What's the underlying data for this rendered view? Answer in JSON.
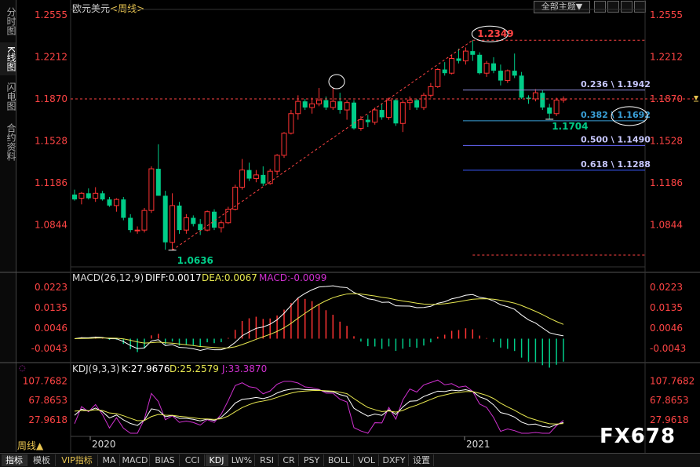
{
  "sidebar": {
    "tabs": [
      {
        "label": "分时图",
        "active": false
      },
      {
        "label": "K线图",
        "active": true
      },
      {
        "label": "闪电图",
        "active": false
      },
      {
        "label": "合约资料",
        "active": false
      }
    ]
  },
  "header": {
    "symbol": "欧元美元",
    "period": "<周线>",
    "theme_button": "全部主题▼"
  },
  "price_axis": {
    "labels": [
      "1.2555",
      "1.2212",
      "1.1870",
      "1.1528",
      "1.1186",
      "1.0844"
    ],
    "current_level": "1.1870"
  },
  "annotations": {
    "high_label": "1.2349",
    "low_label": "1.0636",
    "recent_low_label": "1.1704",
    "fib_levels": [
      {
        "label": "0.236 \\ 1.1942",
        "value": 1.1942,
        "color": "#8a8ad8"
      },
      {
        "label": "0.382 \\ 1.1692",
        "value": 1.1692,
        "color": "#3aa0d8"
      },
      {
        "label": "0.500 \\ 1.1490",
        "value": 1.149,
        "color": "#6a6aff"
      },
      {
        "label": "0.618 \\ 1.1288",
        "value": 1.1288,
        "color": "#3a5aff"
      }
    ]
  },
  "macd": {
    "title": "MACD(26,12,9)",
    "diff_label": "DIFF:0.0017",
    "dea_label": "DEA:0.0067",
    "macd_label": "MACD:-0.0099",
    "axis_labels": [
      "0.0223",
      "0.0135",
      "0.0046",
      "-0.0043"
    ]
  },
  "kdj": {
    "title": "KDJ(9,3,3)",
    "k_label": "K:27.9676",
    "d_label": "D:25.2579",
    "j_label": "J:33.3870",
    "axis_labels": [
      "107.7682",
      "67.8653",
      "27.9618"
    ]
  },
  "time_axis": {
    "labels": [
      "2020",
      "2021"
    ]
  },
  "period_label": "周线▲",
  "bottom_tabs": [
    {
      "label": "指标",
      "active": true,
      "vip": false
    },
    {
      "label": "模板",
      "active": false,
      "vip": false
    },
    {
      "label": "VIP指标",
      "active": false,
      "vip": true
    },
    {
      "label": "MA",
      "active": false,
      "vip": false
    },
    {
      "label": "MACD",
      "active": false,
      "vip": false
    },
    {
      "label": "BIAS",
      "active": false,
      "vip": false
    },
    {
      "label": "CCI",
      "active": false,
      "vip": false
    },
    {
      "label": "KDJ",
      "active": true,
      "vip": false
    },
    {
      "label": "LW%",
      "active": false,
      "vip": false
    },
    {
      "label": "RSI",
      "active": false,
      "vip": false
    },
    {
      "label": "CR",
      "active": false,
      "vip": false
    },
    {
      "label": "PSY",
      "active": false,
      "vip": false
    },
    {
      "label": "BOLL",
      "active": false,
      "vip": false
    },
    {
      "label": "VOL",
      "active": false,
      "vip": false
    },
    {
      "label": "DXFY",
      "active": false,
      "vip": false
    },
    {
      "label": "设置",
      "active": false,
      "vip": false
    }
  ],
  "watermark": "FX678",
  "colors": {
    "up": "#ff3333",
    "down": "#00cc88",
    "diff_line": "#ffffff",
    "dea_line": "#e8e850",
    "j_line": "#d030d0",
    "level_line": "#ff4444"
  },
  "chart_data": {
    "type": "candlestick",
    "y_range": [
      1.05,
      1.26
    ],
    "candles": [
      {
        "o": 1.109,
        "h": 1.113,
        "l": 1.104,
        "c": 1.105
      },
      {
        "o": 1.106,
        "h": 1.111,
        "l": 1.101,
        "c": 1.11
      },
      {
        "o": 1.11,
        "h": 1.114,
        "l": 1.105,
        "c": 1.106
      },
      {
        "o": 1.106,
        "h": 1.115,
        "l": 1.103,
        "c": 1.11
      },
      {
        "o": 1.11,
        "h": 1.112,
        "l": 1.104,
        "c": 1.105
      },
      {
        "o": 1.105,
        "h": 1.107,
        "l": 1.099,
        "c": 1.1
      },
      {
        "o": 1.1,
        "h": 1.106,
        "l": 1.095,
        "c": 1.105
      },
      {
        "o": 1.105,
        "h": 1.107,
        "l": 1.088,
        "c": 1.09
      },
      {
        "o": 1.09,
        "h": 1.093,
        "l": 1.078,
        "c": 1.08
      },
      {
        "o": 1.08,
        "h": 1.083,
        "l": 1.077,
        "c": 1.08
      },
      {
        "o": 1.08,
        "h": 1.098,
        "l": 1.078,
        "c": 1.096
      },
      {
        "o": 1.096,
        "h": 1.132,
        "l": 1.094,
        "c": 1.13
      },
      {
        "o": 1.13,
        "h": 1.15,
        "l": 1.108,
        "c": 1.108
      },
      {
        "o": 1.108,
        "h": 1.112,
        "l": 1.064,
        "c": 1.07
      },
      {
        "o": 1.07,
        "h": 1.11,
        "l": 1.0636,
        "c": 1.1
      },
      {
        "o": 1.1,
        "h": 1.103,
        "l": 1.077,
        "c": 1.08
      },
      {
        "o": 1.08,
        "h": 1.093,
        "l": 1.077,
        "c": 1.09
      },
      {
        "o": 1.09,
        "h": 1.092,
        "l": 1.083,
        "c": 1.085
      },
      {
        "o": 1.085,
        "h": 1.089,
        "l": 1.076,
        "c": 1.08
      },
      {
        "o": 1.08,
        "h": 1.096,
        "l": 1.079,
        "c": 1.095
      },
      {
        "o": 1.095,
        "h": 1.097,
        "l": 1.08,
        "c": 1.082
      },
      {
        "o": 1.082,
        "h": 1.088,
        "l": 1.078,
        "c": 1.086
      },
      {
        "o": 1.086,
        "h": 1.099,
        "l": 1.085,
        "c": 1.097
      },
      {
        "o": 1.097,
        "h": 1.117,
        "l": 1.096,
        "c": 1.115
      },
      {
        "o": 1.115,
        "h": 1.138,
        "l": 1.113,
        "c": 1.129
      },
      {
        "o": 1.129,
        "h": 1.135,
        "l": 1.12,
        "c": 1.122
      },
      {
        "o": 1.122,
        "h": 1.129,
        "l": 1.119,
        "c": 1.125
      },
      {
        "o": 1.125,
        "h": 1.132,
        "l": 1.116,
        "c": 1.118
      },
      {
        "o": 1.118,
        "h": 1.13,
        "l": 1.117,
        "c": 1.128
      },
      {
        "o": 1.128,
        "h": 1.142,
        "l": 1.125,
        "c": 1.141
      },
      {
        "o": 1.141,
        "h": 1.16,
        "l": 1.139,
        "c": 1.159
      },
      {
        "o": 1.159,
        "h": 1.178,
        "l": 1.158,
        "c": 1.175
      },
      {
        "o": 1.175,
        "h": 1.19,
        "l": 1.17,
        "c": 1.185
      },
      {
        "o": 1.185,
        "h": 1.187,
        "l": 1.178,
        "c": 1.18
      },
      {
        "o": 1.18,
        "h": 1.188,
        "l": 1.175,
        "c": 1.183
      },
      {
        "o": 1.183,
        "h": 1.196,
        "l": 1.181,
        "c": 1.186
      },
      {
        "o": 1.186,
        "h": 1.189,
        "l": 1.178,
        "c": 1.18
      },
      {
        "o": 1.18,
        "h": 1.196,
        "l": 1.178,
        "c": 1.185
      },
      {
        "o": 1.185,
        "h": 1.192,
        "l": 1.175,
        "c": 1.178
      },
      {
        "o": 1.178,
        "h": 1.186,
        "l": 1.17,
        "c": 1.184
      },
      {
        "o": 1.184,
        "h": 1.186,
        "l": 1.162,
        "c": 1.163
      },
      {
        "o": 1.163,
        "h": 1.173,
        "l": 1.161,
        "c": 1.17
      },
      {
        "o": 1.17,
        "h": 1.174,
        "l": 1.164,
        "c": 1.168
      },
      {
        "o": 1.168,
        "h": 1.18,
        "l": 1.166,
        "c": 1.178
      },
      {
        "o": 1.178,
        "h": 1.183,
        "l": 1.17,
        "c": 1.172
      },
      {
        "o": 1.172,
        "h": 1.188,
        "l": 1.17,
        "c": 1.186
      },
      {
        "o": 1.186,
        "h": 1.187,
        "l": 1.165,
        "c": 1.167
      },
      {
        "o": 1.167,
        "h": 1.186,
        "l": 1.16,
        "c": 1.184
      },
      {
        "o": 1.184,
        "h": 1.189,
        "l": 1.178,
        "c": 1.186
      },
      {
        "o": 1.186,
        "h": 1.187,
        "l": 1.178,
        "c": 1.18
      },
      {
        "o": 1.18,
        "h": 1.192,
        "l": 1.178,
        "c": 1.19
      },
      {
        "o": 1.19,
        "h": 1.2,
        "l": 1.188,
        "c": 1.197
      },
      {
        "o": 1.197,
        "h": 1.212,
        "l": 1.196,
        "c": 1.211
      },
      {
        "o": 1.211,
        "h": 1.217,
        "l": 1.206,
        "c": 1.208
      },
      {
        "o": 1.208,
        "h": 1.223,
        "l": 1.207,
        "c": 1.22
      },
      {
        "o": 1.22,
        "h": 1.228,
        "l": 1.216,
        "c": 1.218
      },
      {
        "o": 1.218,
        "h": 1.229,
        "l": 1.215,
        "c": 1.226
      },
      {
        "o": 1.226,
        "h": 1.2349,
        "l": 1.218,
        "c": 1.223
      },
      {
        "o": 1.223,
        "h": 1.225,
        "l": 1.207,
        "c": 1.208
      },
      {
        "o": 1.208,
        "h": 1.218,
        "l": 1.205,
        "c": 1.216
      },
      {
        "o": 1.216,
        "h": 1.221,
        "l": 1.208,
        "c": 1.21
      },
      {
        "o": 1.21,
        "h": 1.215,
        "l": 1.198,
        "c": 1.202
      },
      {
        "o": 1.202,
        "h": 1.211,
        "l": 1.2,
        "c": 1.21
      },
      {
        "o": 1.21,
        "h": 1.224,
        "l": 1.204,
        "c": 1.206
      },
      {
        "o": 1.206,
        "h": 1.209,
        "l": 1.187,
        "c": 1.188
      },
      {
        "o": 1.188,
        "h": 1.19,
        "l": 1.183,
        "c": 1.187
      },
      {
        "o": 1.187,
        "h": 1.195,
        "l": 1.185,
        "c": 1.192
      },
      {
        "o": 1.192,
        "h": 1.194,
        "l": 1.178,
        "c": 1.18
      },
      {
        "o": 1.18,
        "h": 1.183,
        "l": 1.1704,
        "c": 1.175
      },
      {
        "o": 1.175,
        "h": 1.188,
        "l": 1.173,
        "c": 1.186
      },
      {
        "o": 1.186,
        "h": 1.189,
        "l": 1.184,
        "c": 1.187
      }
    ]
  }
}
